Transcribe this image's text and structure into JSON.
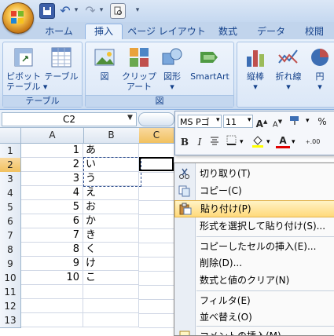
{
  "tabs": [
    "ホーム",
    "挿入",
    "ページ レイアウト",
    "数式",
    "データ",
    "校閲"
  ],
  "ribbon": {
    "groups": [
      {
        "label": "テーブル",
        "buttons": [
          "ピボット\nテーブル ▾",
          "テーブル"
        ]
      },
      {
        "label": "図",
        "buttons": [
          "図",
          "クリップ\nアート",
          "図形\n▾",
          "SmartArt"
        ]
      },
      {
        "label": "",
        "buttons": [
          "縦棒\n▾",
          "折れ線\n▾",
          "円\n▾"
        ]
      }
    ]
  },
  "formula_bar": {
    "name_box": "C2"
  },
  "grid": {
    "columns": [
      "A",
      "B",
      "C"
    ],
    "rows": [
      {
        "num": "1",
        "a": "1",
        "b": "あ"
      },
      {
        "num": "2",
        "a": "2",
        "b": "い"
      },
      {
        "num": "3",
        "a": "3",
        "b": "う"
      },
      {
        "num": "4",
        "a": "4",
        "b": "え"
      },
      {
        "num": "5",
        "a": "5",
        "b": "お"
      },
      {
        "num": "6",
        "a": "6",
        "b": "か"
      },
      {
        "num": "7",
        "a": "7",
        "b": "き"
      },
      {
        "num": "8",
        "a": "8",
        "b": "く"
      },
      {
        "num": "9",
        "a": "9",
        "b": "け"
      },
      {
        "num": "10",
        "a": "10",
        "b": "こ"
      },
      {
        "num": "11",
        "a": "",
        "b": ""
      },
      {
        "num": "12",
        "a": "",
        "b": ""
      },
      {
        "num": "13",
        "a": "",
        "b": ""
      }
    ]
  },
  "mini_toolbar": {
    "font_name": "MS Pゴ",
    "font_size": "11",
    "grow_font": "A",
    "shrink_font": "A",
    "percent": "%",
    "bold": "B",
    "italic": "I",
    "font_color": "A",
    "inc_decimal": ".00"
  },
  "context_menu": {
    "items": [
      {
        "label": "切り取り(T)",
        "icon": "scissors-icon"
      },
      {
        "label": "コピー(C)",
        "icon": "copy-icon"
      },
      {
        "label": "貼り付け(P)",
        "icon": "paste-icon",
        "highlighted": true
      },
      {
        "label": "形式を選択して貼り付け(S)...",
        "icon": ""
      },
      {
        "label": "コピーしたセルの挿入(E)...",
        "icon": ""
      },
      {
        "label": "削除(D)...",
        "icon": ""
      },
      {
        "label": "数式と値のクリア(N)",
        "icon": ""
      },
      {
        "label": "フィルタ(E)",
        "icon": ""
      },
      {
        "label": "並べ替え(O)",
        "icon": ""
      },
      {
        "label": "コメントの挿入(M)",
        "icon": "comment-icon"
      }
    ]
  },
  "colors": {
    "accent": "#15428b",
    "highlight": "#ffd97a",
    "selected_header": "#f1c15f"
  }
}
